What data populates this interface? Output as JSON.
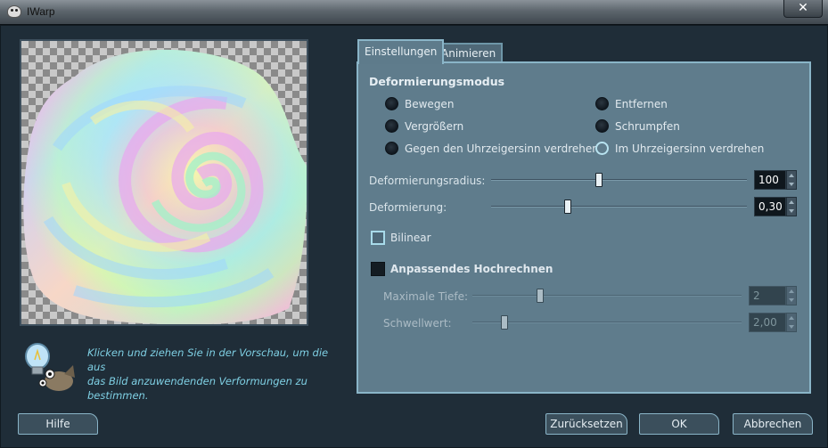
{
  "window": {
    "title": "IWarp",
    "close_symbol": "✕"
  },
  "hint": {
    "icon": "hint-lightbulb-wilber-icon",
    "text": "Klicken und ziehen Sie in der Vorschau, um die aus\ndas Bild anzuwendenden Verformungen zu\nbestimmen."
  },
  "tabs": [
    {
      "label": "Einstellungen",
      "active": true
    },
    {
      "label": "Animieren",
      "active": false
    }
  ],
  "settings": {
    "mode_title": "Deformierungsmodus",
    "modes": [
      {
        "label": "Bewegen",
        "checked": false
      },
      {
        "label": "Entfernen",
        "checked": false
      },
      {
        "label": "Vergrößern",
        "checked": false
      },
      {
        "label": "Schrumpfen",
        "checked": false
      },
      {
        "label": "Gegen den Uhrzeigersinn verdrehen",
        "checked": false
      },
      {
        "label": "Im Uhrzeigersinn verdrehen",
        "checked": true
      }
    ],
    "radius": {
      "label": "Deformierungsradius:",
      "value": "100",
      "level": 0.42
    },
    "amount": {
      "label": "Deformierung:",
      "value": "0,30",
      "level": 0.3
    },
    "bilinear": {
      "label": "Bilinear",
      "checked": false
    },
    "adaptive": {
      "label": "Anpassendes Hochrechnen",
      "checked": false
    },
    "max_depth": {
      "label": "Maximale Tiefe:",
      "value": "2",
      "level": 0.25
    },
    "threshold": {
      "label": "Schwellwert:",
      "value": "2,00",
      "level": 0.12
    }
  },
  "buttons": {
    "help": "Hilfe",
    "reset": "Zurücksetzen",
    "ok": "OK",
    "cancel": "Abbrechen"
  }
}
